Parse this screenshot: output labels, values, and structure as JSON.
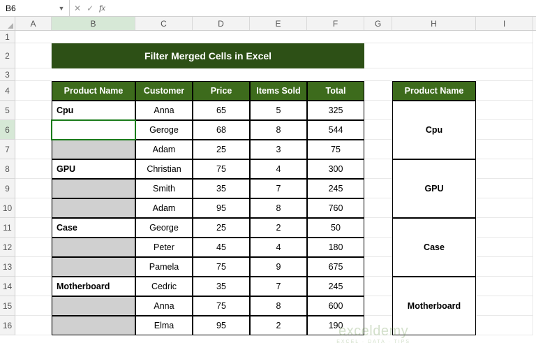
{
  "nameBox": "B6",
  "formula": "",
  "columns": [
    "A",
    "B",
    "C",
    "D",
    "E",
    "F",
    "G",
    "H",
    "I"
  ],
  "rows": [
    "1",
    "2",
    "3",
    "4",
    "5",
    "6",
    "7",
    "8",
    "9",
    "10",
    "11",
    "12",
    "13",
    "14",
    "15",
    "16"
  ],
  "activeCol": "B",
  "activeRow": "6",
  "title": "Filter Merged Cells in Excel",
  "headers": {
    "product": "Product Name",
    "customer": "Customer",
    "price": "Price",
    "items": "Items Sold",
    "total": "Total"
  },
  "sideHeader": "Product Name",
  "data": [
    {
      "product": "Cpu",
      "rows": [
        {
          "customer": "Anna",
          "price": "65",
          "items": "5",
          "total": "325"
        },
        {
          "customer": "Geroge",
          "price": "68",
          "items": "8",
          "total": "544"
        },
        {
          "customer": "Adam",
          "price": "25",
          "items": "3",
          "total": "75"
        }
      ]
    },
    {
      "product": "GPU",
      "rows": [
        {
          "customer": "Christian",
          "price": "75",
          "items": "4",
          "total": "300"
        },
        {
          "customer": "Smith",
          "price": "35",
          "items": "7",
          "total": "245"
        },
        {
          "customer": "Adam",
          "price": "95",
          "items": "8",
          "total": "760"
        }
      ]
    },
    {
      "product": "Case",
      "rows": [
        {
          "customer": "George",
          "price": "25",
          "items": "2",
          "total": "50"
        },
        {
          "customer": "Peter",
          "price": "45",
          "items": "4",
          "total": "180"
        },
        {
          "customer": "Pamela",
          "price": "75",
          "items": "9",
          "total": "675"
        }
      ]
    },
    {
      "product": "Motherboard",
      "rows": [
        {
          "customer": "Cedric",
          "price": "35",
          "items": "7",
          "total": "245"
        },
        {
          "customer": "Anna",
          "price": "75",
          "items": "8",
          "total": "600"
        },
        {
          "customer": "Elma",
          "price": "95",
          "items": "2",
          "total": "190"
        }
      ]
    }
  ],
  "sideProducts": [
    "Cpu",
    "GPU",
    "Case",
    "Motherboard"
  ],
  "watermark": {
    "name": "exceldemy",
    "tag": "EXCEL · DATA · TIPS"
  }
}
